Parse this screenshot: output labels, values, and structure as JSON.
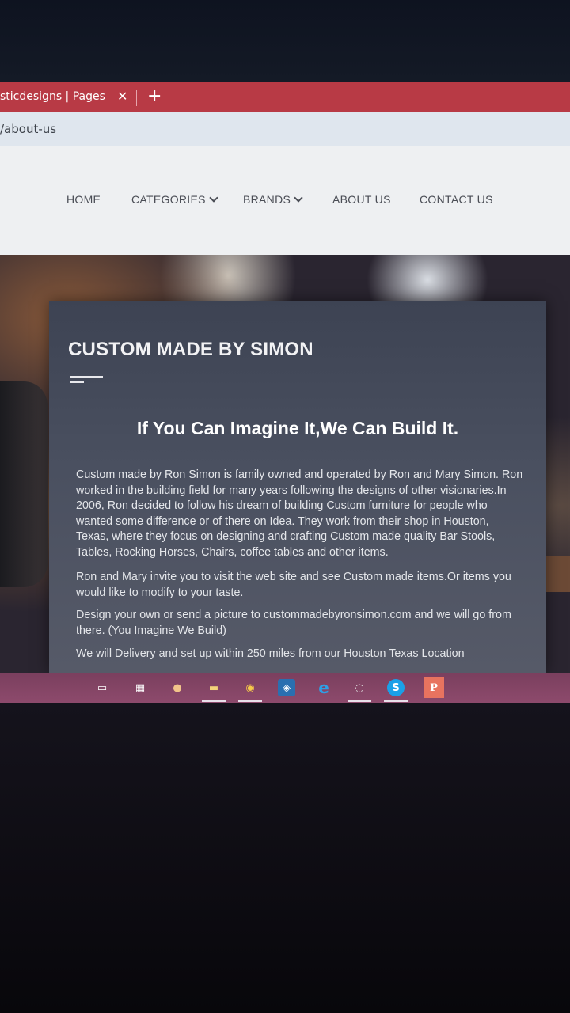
{
  "browser": {
    "tab": {
      "title": "sticdesigns | Pages",
      "close_glyph": "✕",
      "new_tab_glyph": "+"
    },
    "address": {
      "url": "/about-us"
    }
  },
  "nav": {
    "items": [
      {
        "label": "HOME",
        "has_dropdown": false
      },
      {
        "label": "CATEGORIES",
        "has_dropdown": true
      },
      {
        "label": "BRANDS",
        "has_dropdown": true
      },
      {
        "label": "ABOUT US",
        "has_dropdown": false
      },
      {
        "label": "CONTACT US",
        "has_dropdown": false
      }
    ]
  },
  "card": {
    "title": "CUSTOM MADE BY SIMON",
    "tagline": "If You Can Imagine It,We Can Build It.",
    "paragraphs": [
      "Custom made by Ron Simon is family owned and operated by Ron and Mary Simon. Ron worked in the building field for many years following the designs of other visionaries.In 2006, Ron decided to follow his dream of building Custom furniture for people who wanted some difference or of there on Idea. They work from their shop in Houston, Texas, where they focus on designing and crafting Custom made quality Bar Stools, Tables, Rocking Horses, Chairs, coffee tables and other items.",
      "Ron and Mary invite you to visit the web site and see Custom made items.Or items you would like to modify to your taste.",
      "Design your own or send a picture to custommadebyronsimon.com  and we will go from there. (You Imagine We Build)",
      "We will Delivery and set up within 250 miles from our Houston Texas Location"
    ]
  },
  "taskbar": {
    "icons": [
      {
        "name": "task-view-icon",
        "glyph": "▭"
      },
      {
        "name": "store-icon",
        "glyph": "▦"
      },
      {
        "name": "photos-app-icon",
        "glyph": "●"
      },
      {
        "name": "file-explorer-icon",
        "glyph": "▬"
      },
      {
        "name": "chrome-icon",
        "glyph": "◉"
      },
      {
        "name": "app-icon",
        "glyph": "◈"
      },
      {
        "name": "edge-icon",
        "glyph": "e"
      },
      {
        "name": "media-icon",
        "glyph": "◌"
      },
      {
        "name": "skype-icon",
        "glyph": "S"
      },
      {
        "name": "pages-app-icon",
        "glyph": "P"
      }
    ]
  },
  "colors": {
    "tabbar": "#b83a45",
    "taskbar": "#8d4a6c",
    "card": "#4a5060"
  }
}
